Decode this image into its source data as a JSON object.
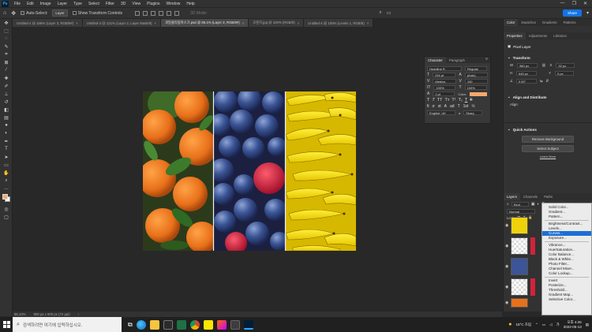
{
  "menubar": {
    "items": [
      "File",
      "Edit",
      "Image",
      "Layer",
      "Type",
      "Select",
      "Filter",
      "3D",
      "View",
      "Plugins",
      "Window",
      "Help"
    ],
    "window_controls": [
      "—",
      "❐",
      "✕"
    ]
  },
  "options_bar": {
    "auto_select_label": "Auto-Select:",
    "auto_select_value": "Layer",
    "show_transform_label": "Show Transform Controls",
    "mode_label": "3D Mode:",
    "share_label": "Share"
  },
  "tabs": [
    {
      "label": "Untitled-2 @ 166% (Layer 3, RGB/8#)",
      "active": false
    },
    {
      "label": "Untitled-3 @ 121% (Layer 2, Layer Mask/8)",
      "active": false
    },
    {
      "label": "과일클리핑마스크.psd @ 86.1% (Layer 3, RGB/8#)",
      "active": true
    },
    {
      "label": "오렌지.jpg @ 100% (RGB/8)",
      "active": false
    },
    {
      "label": "Untitled-4 @ 100% (Levels 1, RGB/8)",
      "active": false
    }
  ],
  "character_panel": {
    "tab_character": "Character",
    "tab_paragraph": "Paragraph",
    "font_family": "Headline R",
    "font_style": "Regular",
    "font_size": "234 pt",
    "leading": "(Auto)",
    "kerning": "Metrics",
    "tracking": "100",
    "vscale": "100%",
    "hscale": "100%",
    "baseline": "0 pt",
    "color_label": "Color:",
    "color_swatch": "#f7a96b",
    "language": "English: UK",
    "aa": "a",
    "aa_mode": "Sharp"
  },
  "right_dock": {
    "top_tabs": [
      "Color",
      "Swatches",
      "Gradients",
      "Patterns"
    ],
    "prop_tabs": [
      "Properties",
      "Adjustments",
      "Libraries"
    ],
    "pixel_layer": "Pixel Layer",
    "transform_title": "Transform",
    "w_label": "W",
    "w_value": "960 px",
    "h_label": "H",
    "h_value": "640 px",
    "x_label": "X",
    "x_value": "32 px",
    "y_label": "Y",
    "y_value": "0 px",
    "angle_value": "0.00°",
    "align_title": "Align and Distribute",
    "align_label": "Align:",
    "quick_actions_title": "Quick Actions",
    "remove_bg": "Remove Background",
    "select_subject": "Select Subject",
    "learn_more": "Learn More",
    "layer_tabs": [
      "Layers",
      "Channels",
      "Paths"
    ],
    "kind_label": "Kind",
    "blend_mode": "Normal",
    "lock_label": "Lock:"
  },
  "adjustment_menu": {
    "groups": [
      [
        "Solid Color...",
        "Gradient...",
        "Pattern..."
      ],
      [
        "Brightness/Contrast...",
        "Levels...",
        "Curves...",
        "Exposure..."
      ],
      [
        "Vibrance...",
        "Hue/Saturation...",
        "Color Balance...",
        "Black & White...",
        "Photo Filter...",
        "Channel Mixer...",
        "Color Lookup..."
      ],
      [
        "Invert",
        "Posterize...",
        "Threshold...",
        "Gradient Map...",
        "Selective Color..."
      ]
    ],
    "highlighted": "Curves..."
  },
  "status_bar": {
    "zoom": "86.10%",
    "doc_size": "800 px x 600 px (72 ppi)"
  },
  "taskbar": {
    "search_placeholder": "검색하려면 여기에 입력하십시오.",
    "weather": "15°C 흐림",
    "time": "오후 4:26",
    "date": "2022-05-13",
    "ime": "가"
  }
}
